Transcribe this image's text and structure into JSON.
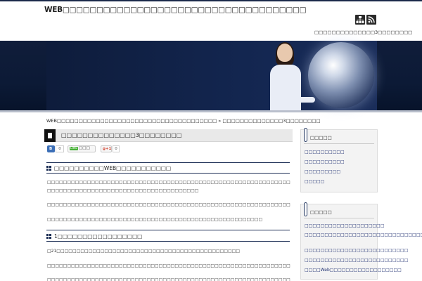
{
  "header": {
    "site_title": "WEB□□□□□□□□□□□□□□□□□□□□□□□□□□□□□□□□□□□□",
    "tagline": "□□□□□□□□□□□□□□3□□□□□□□□"
  },
  "breadcrumb": "WEB□□□□□□□□□□□□□□□□□□□□□□□□□□□□□□□□□□□□□ » □□□□□□□□□□□□□□3□□□□□□□□",
  "article": {
    "title": "□□□□□□□□□□□□□□3□□□□□□□□",
    "share": {
      "hatena_label": "B",
      "hatena_count": "0",
      "line_label": "LINE",
      "line_suffix": "□□□",
      "gplus_label": "g+1",
      "gplus_count": "0"
    },
    "sections": [
      {
        "heading": "□□□□□□□□□□WEB□□□□□□□□□□□",
        "paragraphs": [
          "□□□□□□□□□□□□□□□□□□□□□□□□□□□□□□□□□□□□□□□□□□□□□□□□□□□□□□□□□□□□□□□□□□□□□□□□□□□□□□□□□□□",
          "□□□□□□□□□□□□□□□□□□□□□□□□□□□□□□□□□□□□□□",
          "□□□□□□□□□□□□□□□□□□□□□□□□□□□□□□□□□□□□□□□□□□□□□□□□□□□□□□□□□□□□□□□□□□□□□",
          "□□□□□□□□□□□□□□□□□□□□□□□□□□□□□□□□□□□□□□□□□□□□□□□□□□□□□□"
        ]
      },
      {
        "heading": "1□□□□□□□□□□□□□□□□□",
        "paragraphs": [
          "□21□□□□□□□□□□□□□□□□□□□□□□□□□□□□□□□□□□□□□□□□□□□□□□",
          "□□□□□□□□□□□□□□□□□□□□□□□□□□□□□□□□□□□□□□□□□□□□□□□□□□□□□□□□□□□□□□□□□□□□",
          "□□□□□□□□□□□□□□□□□□□□□□□□□□□□□□□□□□□□□□□□□□□□□□□□□□□□□□□□□□□□□□□□□□□□□"
        ]
      }
    ]
  },
  "sidebar": {
    "widgets": [
      {
        "title": "□□□□□",
        "items": [
          "□□□□□□□□□□",
          "□□□□□□□□□□",
          "□□□□□□□□□",
          "□□□□□"
        ]
      },
      {
        "title": "□□□□□",
        "items": [
          "□□□□□□□□□□□□□□□□□□□□",
          "□□□□□□□□□□□□□□□□□□□□□□□□□□□□□□□□□",
          "□□□□□□□□□□□□□□□□□□□□□□□□□□",
          "□□□□□□□□□□□□□□□□□□□□□□□□□□",
          "□□□□Web□□□□□□□□□□□□□□□□□□"
        ]
      }
    ]
  },
  "icons": {
    "sitemap": "sitemap-icon",
    "rss": "rss-icon"
  },
  "colors": {
    "hero_bg": "#0c1a36",
    "accent": "#1c2e55",
    "link": "#1c2e70"
  }
}
